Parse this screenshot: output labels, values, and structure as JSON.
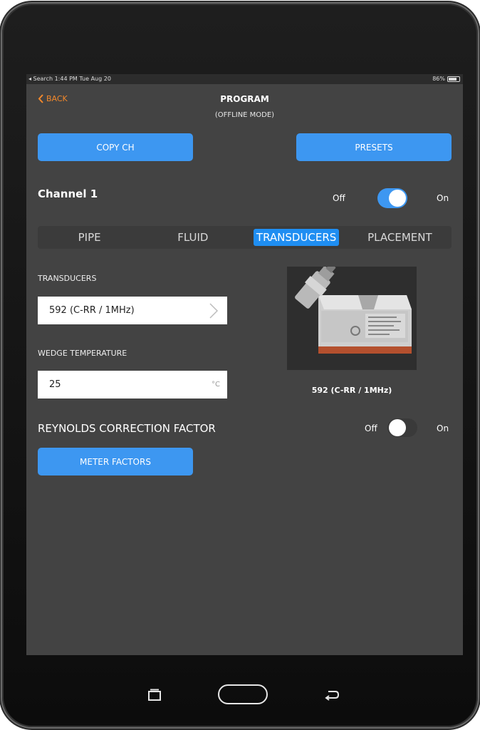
{
  "status_bar": {
    "left": "◂ Search  1:44 PM   Tue Aug 20",
    "battery": "86%"
  },
  "nav": {
    "back_label": "BACK",
    "title": "PROGRAM",
    "subtitle": "(OFFLINE MODE)"
  },
  "actions": {
    "copy_label": "COPY CH",
    "presets_label": "PRESETS"
  },
  "channel": {
    "title": "Channel 1",
    "off_label": "Off",
    "on_label": "On",
    "enabled": true
  },
  "tabs": [
    {
      "label": "PIPE",
      "active": false
    },
    {
      "label": "FLUID",
      "active": false
    },
    {
      "label": "TRANSDUCERS",
      "active": true
    },
    {
      "label": "PLACEMENT",
      "active": false
    }
  ],
  "transducers": {
    "label": "TRANSDUCERS",
    "value": "592 (C-RR / 1MHz)"
  },
  "wedge": {
    "label": "WEDGE TEMPERATURE",
    "value": "25",
    "unit": "°C"
  },
  "image": {
    "caption": "592 (C-RR / 1MHz)"
  },
  "reynolds": {
    "label": "REYNOLDS CORRECTION FACTOR",
    "off_label": "Off",
    "on_label": "On",
    "enabled": false
  },
  "meter": {
    "label": "METER FACTORS"
  },
  "colors": {
    "accent": "#3d97f1",
    "back": "#f2882c",
    "screen_bg": "#434343"
  }
}
